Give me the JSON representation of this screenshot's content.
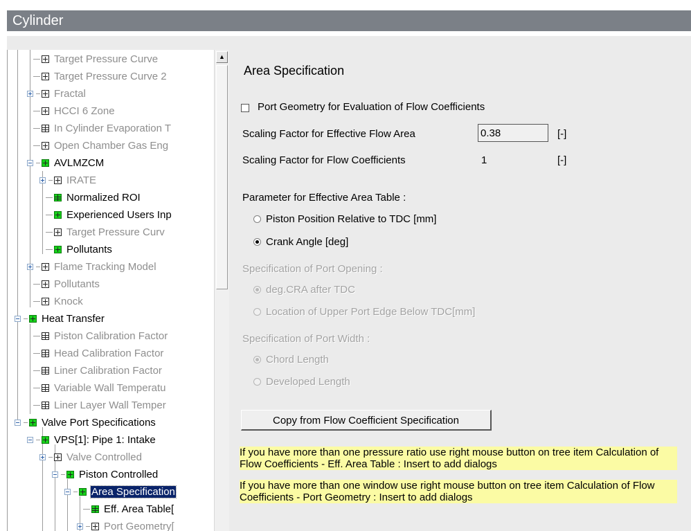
{
  "window": {
    "title": "Cylinder"
  },
  "tree": {
    "items": [
      {
        "label": "Target Pressure Curve",
        "grey": true
      },
      {
        "label": "Target Pressure Curve 2",
        "grey": true
      },
      {
        "label": "Fractal",
        "grey": true
      },
      {
        "label": "HCCI 6 Zone",
        "grey": true
      },
      {
        "label": "In Cylinder Evaporation T",
        "grey": true
      },
      {
        "label": "Open Chamber Gas Eng",
        "grey": true
      },
      {
        "label": "AVLMZCM",
        "grey": false
      },
      {
        "label": "IRATE",
        "grey": true
      },
      {
        "label": "Normalized ROI",
        "grey": false
      },
      {
        "label": "Experienced Users Inp",
        "grey": false
      },
      {
        "label": "Target Pressure Curv",
        "grey": true
      },
      {
        "label": "Pollutants",
        "grey": false
      },
      {
        "label": "Flame Tracking Model",
        "grey": true
      },
      {
        "label": "Pollutants",
        "grey": true
      },
      {
        "label": "Knock",
        "grey": true
      },
      {
        "label": "Heat Transfer",
        "grey": false
      },
      {
        "label": "Piston Calibration Factor",
        "grey": true
      },
      {
        "label": "Head Calibration Factor",
        "grey": true
      },
      {
        "label": "Liner Calibration Factor",
        "grey": true
      },
      {
        "label": "Variable Wall Temperatu",
        "grey": true
      },
      {
        "label": "Liner Layer Wall Temper",
        "grey": true
      },
      {
        "label": "Valve Port Specifications",
        "grey": false
      },
      {
        "label": "VPS[1]: Pipe 1: Intake",
        "grey": false
      },
      {
        "label": "Valve Controlled",
        "grey": true
      },
      {
        "label": "Piston Controlled",
        "grey": false
      },
      {
        "label": "Area Specification",
        "grey": false,
        "selected": true
      },
      {
        "label": "Eff. Area Table[",
        "grey": false
      },
      {
        "label": "Port Geometry[",
        "grey": true
      }
    ]
  },
  "panel": {
    "title": "Area Specification",
    "port_geometry_checkbox": {
      "label": "Port Geometry for Evaluation of Flow Coefficients",
      "checked": false
    },
    "scaling_eff_area": {
      "label": "Scaling Factor for Effective Flow Area",
      "value": "0.38",
      "unit": "[-]"
    },
    "scaling_flow_coeff": {
      "label": "Scaling Factor for Flow Coefficients",
      "value": "1",
      "unit": "[-]"
    },
    "eff_area_param": {
      "label": "Parameter for Effective Area Table :",
      "options": [
        "Piston Position Relative to TDC [mm]",
        "Crank Angle [deg]"
      ],
      "selected": 1
    },
    "port_opening": {
      "label": "Specification of Port Opening :",
      "options": [
        "deg.CRA after TDC",
        "Location of Upper Port Edge Below TDC[mm]"
      ],
      "selected": 0
    },
    "port_width": {
      "label": "Specification of Port Width :",
      "options": [
        "Chord Length",
        "Developed Length"
      ],
      "selected": 0
    },
    "copy_button": "Copy from Flow Coefficient Specification",
    "notes": [
      "If you have more than one pressure ratio use right mouse button on tree item Calculation of Flow Coefficients - Eff. Area Table : Insert to add dialogs",
      "If you have more than one window use right mouse button on tree item Calculation of Flow Coefficients - Port Geometry : Insert to add dialogs"
    ]
  }
}
